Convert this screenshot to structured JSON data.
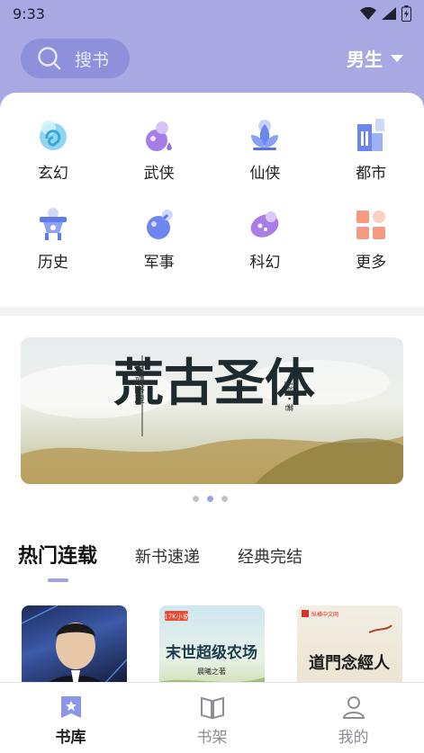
{
  "status": {
    "time": "9:33"
  },
  "header": {
    "search_label": "搜书",
    "gender_label": "男生",
    "bg_color": "#a8a9e3"
  },
  "categories": [
    {
      "label": "玄幻",
      "icon": "swirl-icon"
    },
    {
      "label": "武侠",
      "icon": "gourd-icon"
    },
    {
      "label": "仙侠",
      "icon": "lotus-icon"
    },
    {
      "label": "都市",
      "icon": "buildings-icon"
    },
    {
      "label": "历史",
      "icon": "bell-icon"
    },
    {
      "label": "军事",
      "icon": "bomb-icon"
    },
    {
      "label": "科幻",
      "icon": "planet-icon"
    },
    {
      "label": "更多",
      "icon": "grid-icon"
    }
  ],
  "banner": {
    "title": "荒古圣体",
    "side_text": "开局签到",
    "author_text": "J神 • 著"
  },
  "tabs": [
    {
      "label": "热门连载",
      "active": true
    },
    {
      "label": "新书速递",
      "active": false
    },
    {
      "label": "经典完结",
      "active": false
    }
  ],
  "books": [
    {
      "cover_text": ""
    },
    {
      "cover_tag": "17K小说",
      "cover_text": "末世超级农场",
      "author_text": "晨曦之著"
    },
    {
      "cover_tag": "纵横中文网",
      "cover_text": "道門念經人"
    }
  ],
  "bottom_nav": [
    {
      "label": "书库",
      "icon": "library-icon",
      "active": true
    },
    {
      "label": "书架",
      "icon": "bookshelf-icon",
      "active": false
    },
    {
      "label": "我的",
      "icon": "profile-icon",
      "active": false
    }
  ],
  "accent_color": "#9fa0e6"
}
